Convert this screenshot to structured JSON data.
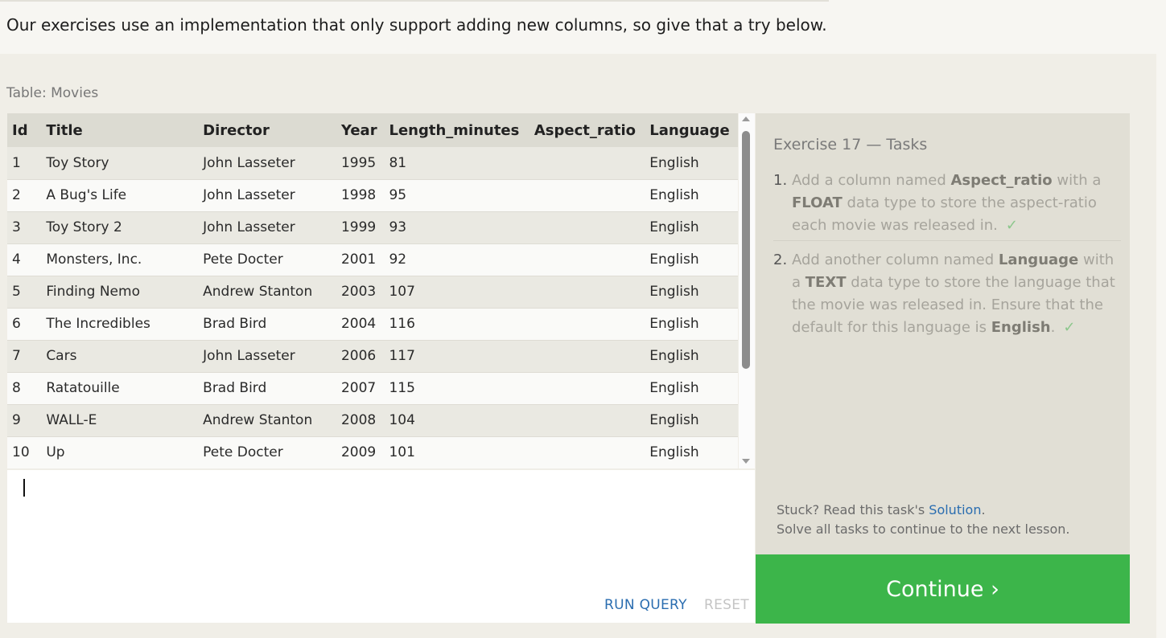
{
  "intro": {
    "text": "Our exercises use an implementation that only support adding new columns, so give that a try below."
  },
  "table": {
    "caption": "Table: Movies",
    "columns": [
      "Id",
      "Title",
      "Director",
      "Year",
      "Length_minutes",
      "Aspect_ratio",
      "Language"
    ],
    "rows": [
      [
        "1",
        "Toy Story",
        "John Lasseter",
        "1995",
        "81",
        "",
        "English"
      ],
      [
        "2",
        "A Bug's Life",
        "John Lasseter",
        "1998",
        "95",
        "",
        "English"
      ],
      [
        "3",
        "Toy Story 2",
        "John Lasseter",
        "1999",
        "93",
        "",
        "English"
      ],
      [
        "4",
        "Monsters, Inc.",
        "Pete Docter",
        "2001",
        "92",
        "",
        "English"
      ],
      [
        "5",
        "Finding Nemo",
        "Andrew Stanton",
        "2003",
        "107",
        "",
        "English"
      ],
      [
        "6",
        "The Incredibles",
        "Brad Bird",
        "2004",
        "116",
        "",
        "English"
      ],
      [
        "7",
        "Cars",
        "John Lasseter",
        "2006",
        "117",
        "",
        "English"
      ],
      [
        "8",
        "Ratatouille",
        "Brad Bird",
        "2007",
        "115",
        "",
        "English"
      ],
      [
        "9",
        "WALL-E",
        "Andrew Stanton",
        "2008",
        "104",
        "",
        "English"
      ],
      [
        "10",
        "Up",
        "Pete Docter",
        "2009",
        "101",
        "",
        "English"
      ]
    ]
  },
  "editor": {
    "run_label": "RUN QUERY",
    "reset_label": "RESET"
  },
  "tasks": {
    "title": "Exercise 17 — Tasks",
    "items": [
      {
        "num": "1.",
        "pre": "Add a column named ",
        "b1": "Aspect_ratio",
        "mid": " with a ",
        "b2": "FLOAT",
        "post": " data type to store the aspect-ratio each movie was released in.",
        "b3": "",
        "end": "",
        "check": "✓"
      },
      {
        "num": "2.",
        "pre": "Add another column named ",
        "b1": "Language",
        "mid": " with a ",
        "b2": "TEXT",
        "post": " data type to store the language that the movie was released in. Ensure that the default for this language is ",
        "b3": "English",
        "end": ".",
        "check": "✓"
      }
    ],
    "stuck_text": "Stuck? Read this task's ",
    "solution_label": "Solution",
    "stuck_end": ".",
    "solve_all": "Solve all tasks to continue to the next lesson."
  },
  "continue_label": "Continue ›",
  "colors": {
    "accent_green": "#3cb54a",
    "link_blue": "#2a6db0"
  }
}
